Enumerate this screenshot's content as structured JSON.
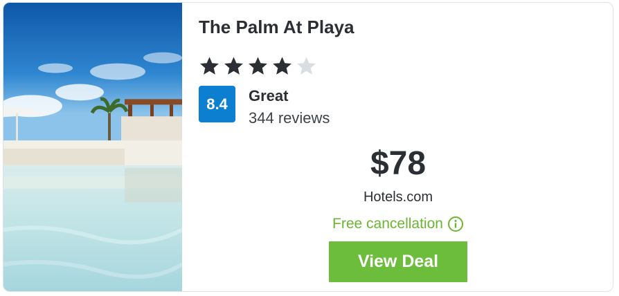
{
  "hotel": {
    "name": "The Palm At Playa",
    "stars": 4,
    "max_stars": 5,
    "score": "8.4",
    "rating_label": "Great",
    "reviews": "344 reviews"
  },
  "deal": {
    "price": "$78",
    "provider": "Hotels.com",
    "free_cancellation": "Free cancellation",
    "button_label": "View Deal"
  },
  "colors": {
    "score_badge": "#0c7fd0",
    "free_cancellation": "#6ab631",
    "button": "#6cbd3b",
    "star_filled": "#2b2f33",
    "star_empty": "#d9dee3"
  },
  "icons": {
    "star": "star-icon",
    "info": "info-icon"
  }
}
